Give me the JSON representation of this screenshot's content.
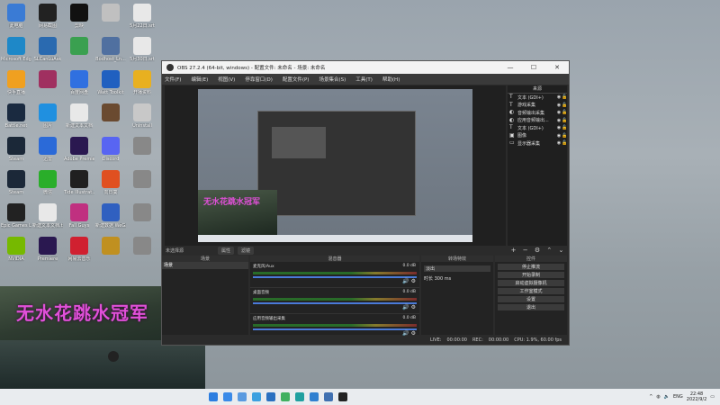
{
  "desktop": {
    "icons": [
      {
        "label": "此电脑",
        "color": "#3a7bd5"
      },
      {
        "label": "网易截图",
        "color": "#222222"
      },
      {
        "label": "剪映",
        "color": "#111111"
      },
      {
        "label": "",
        "color": "#c0c0c0"
      },
      {
        "label": "5月22日.srt",
        "color": "#e8e8e8"
      },
      {
        "label": "Microsoft Edge",
        "color": "#1e88c8"
      },
      {
        "label": "SLCanLuAsk",
        "color": "#2a6ab0"
      },
      {
        "label": "",
        "color": "#3aa050"
      },
      {
        "label": "Bodhost_Ln...",
        "color": "#5070a0"
      },
      {
        "label": "5月30日.srt",
        "color": "#e8e8e8"
      },
      {
        "label": "快手直播",
        "color": "#f0a020"
      },
      {
        "label": "",
        "color": "#a03060"
      },
      {
        "label": "百度网盘",
        "color": "#3070e0"
      },
      {
        "label": "Watt Toolkit",
        "color": "#2060c0"
      },
      {
        "label": "开播资料",
        "color": "#e8b020"
      },
      {
        "label": "Battle.net",
        "color": "#1a2a40"
      },
      {
        "label": "图片",
        "color": "#2090e0"
      },
      {
        "label": "新建文本文档",
        "color": "#e8e8e8"
      },
      {
        "label": "",
        "color": "#6a4a30"
      },
      {
        "label": "Uninstall",
        "color": "#c8c8c8"
      },
      {
        "label": "Steam",
        "color": "#1b2838"
      },
      {
        "label": "迅雷",
        "color": "#2b6ad8"
      },
      {
        "label": "Adobe Premiere",
        "color": "#2a1850"
      },
      {
        "label": "Discord",
        "color": "#5865f2"
      },
      {
        "label": "",
        "color": "#888888"
      },
      {
        "label": "Steam",
        "color": "#1b2838"
      },
      {
        "label": "微信",
        "color": "#2aae2a"
      },
      {
        "label": "Tide Illustrat...",
        "color": "#202020"
      },
      {
        "label": "向日葵",
        "color": "#e05020"
      },
      {
        "label": "",
        "color": "#888888"
      },
      {
        "label": "Epic Games Launcher",
        "color": "#222222"
      },
      {
        "label": "新建文本文档.txt",
        "color": "#e8e8e8"
      },
      {
        "label": "Fall Guys",
        "color": "#c03080"
      },
      {
        "label": "新建数据 WeGameMy",
        "color": "#3060c0"
      },
      {
        "label": "",
        "color": "#888888"
      },
      {
        "label": "NVIDIA",
        "color": "#76b900"
      },
      {
        "label": "Premiere",
        "color": "#2a1850"
      },
      {
        "label": "网易云音乐",
        "color": "#d02030"
      },
      {
        "label": "",
        "color": "#c09020"
      },
      {
        "label": "",
        "color": "#888888"
      }
    ]
  },
  "game_overlay": {
    "title": "无水花跳水冠军"
  },
  "obs": {
    "title": "OBS 27.2.4 (64-bit, windows) - 配置文件: 未命名 - 场景: 未命名",
    "menu": [
      "文件(F)",
      "编辑(E)",
      "视图(V)",
      "停靠窗口(D)",
      "配置文件(P)",
      "场景集合(S)",
      "工具(T)",
      "帮助(H)"
    ],
    "preview_overlay_text": "无水花跳水冠军",
    "sources_header": "来源",
    "sources": [
      {
        "icon": "T",
        "name": "文本 (GDI+)"
      },
      {
        "icon": "T",
        "name": "游戏采集"
      },
      {
        "icon": "◐",
        "name": "音频输出采集"
      },
      {
        "icon": "◐",
        "name": "应用音频输出..."
      },
      {
        "icon": "T",
        "name": "文本 (GDI+)"
      },
      {
        "icon": "▣",
        "name": "图像"
      },
      {
        "icon": "▭",
        "name": "显示器采集"
      }
    ],
    "scene_bar": {
      "label": "未选择源",
      "btn1": "属性",
      "btn2": "滤镜"
    },
    "scenes_header": "场景",
    "scenes": [
      "场景"
    ],
    "mixer_header": "混音器",
    "mixer": [
      {
        "name": "麦克风/Aux",
        "db": "0.0 dB"
      },
      {
        "name": "桌面音频",
        "db": "0.0 dB"
      },
      {
        "name": "应用音频输出采集",
        "db": "0.0 dB"
      }
    ],
    "transitions_header": "转场特效",
    "transition_value": "淡出",
    "duration_label": "时长",
    "duration_value": "300 ms",
    "controls_header": "控件",
    "controls": [
      "停止推流",
      "开始录制",
      "启动虚拟摄像机",
      "工作室模式",
      "设置",
      "退出"
    ],
    "status": {
      "live_label": "LIVE:",
      "live_time": "00:00:00",
      "rec_label": "REC:",
      "rec_time": "00:00:00",
      "cpu": "CPU: 1.9%, 60.00 fps"
    }
  },
  "taskbar": {
    "icons": [
      {
        "name": "start",
        "color": "#2b7de0"
      },
      {
        "name": "app2",
        "color": "#3a8ae8"
      },
      {
        "name": "app3",
        "color": "#5a9ae0"
      },
      {
        "name": "app4",
        "color": "#3ba0e0"
      },
      {
        "name": "app5",
        "color": "#2a70c0"
      },
      {
        "name": "app6",
        "color": "#40b060"
      },
      {
        "name": "app7",
        "color": "#20a0a0"
      },
      {
        "name": "app8",
        "color": "#3080d0"
      },
      {
        "name": "app9",
        "color": "#4070b0"
      },
      {
        "name": "obs",
        "color": "#222222"
      }
    ],
    "lang": "ENG",
    "time": "22:48",
    "date": "2022/9/2"
  }
}
